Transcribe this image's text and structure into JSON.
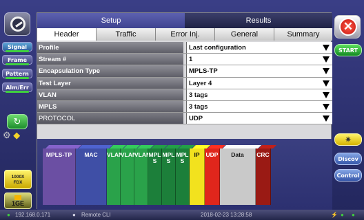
{
  "left_rail": {
    "tabs": [
      "Signal",
      "Frame",
      "Pattern",
      "Alm/Err"
    ],
    "rate_label": "1000X\nFDX",
    "port_label": "1GE"
  },
  "right_rail": {
    "start_label": "START",
    "discover_label": "Discov",
    "control_label": "Control"
  },
  "top_tabs": [
    "Setup",
    "Results"
  ],
  "sub_tabs": [
    "Header",
    "Traffic",
    "Error Inj.",
    "General",
    "Summary"
  ],
  "rows": [
    {
      "label": "Profile",
      "value": "Last configuration"
    },
    {
      "label": "Stream #",
      "value": "1"
    },
    {
      "label": "Encapsulation Type",
      "value": "MPLS-TP"
    },
    {
      "label": "Test Layer",
      "value": "Layer 4"
    },
    {
      "label": "VLAN",
      "value": "3 tags"
    },
    {
      "label": "MPLS",
      "value": "3 tags"
    },
    {
      "label": "PROTOCOL",
      "value": "UDP"
    }
  ],
  "diagram": [
    {
      "label": "MPLS-TP",
      "color": "#6b4fa3"
    },
    {
      "label": "MAC",
      "color": "#3f4fa6"
    },
    {
      "label": "VLAN",
      "color": "#2aa24a"
    },
    {
      "label": "VLAN",
      "color": "#2aa24a"
    },
    {
      "label": "VLAN",
      "color": "#2aa24a"
    },
    {
      "label": "MPL S",
      "color": "#1c7f3a"
    },
    {
      "label": "MPL S",
      "color": "#1c7f3a"
    },
    {
      "label": "MPL S",
      "color": "#1c7f3a"
    },
    {
      "label": "IP",
      "color": "#f2e21e"
    },
    {
      "label": "UDP",
      "color": "#e0261c"
    },
    {
      "label": "Data",
      "color": "#c9c9c9"
    },
    {
      "label": "CRC",
      "color": "#9a1a14"
    }
  ],
  "status_bar": {
    "ip": "192.168.0.171",
    "remote": "Remote CLI",
    "datetime": "2018-02-23 13:28:58"
  }
}
